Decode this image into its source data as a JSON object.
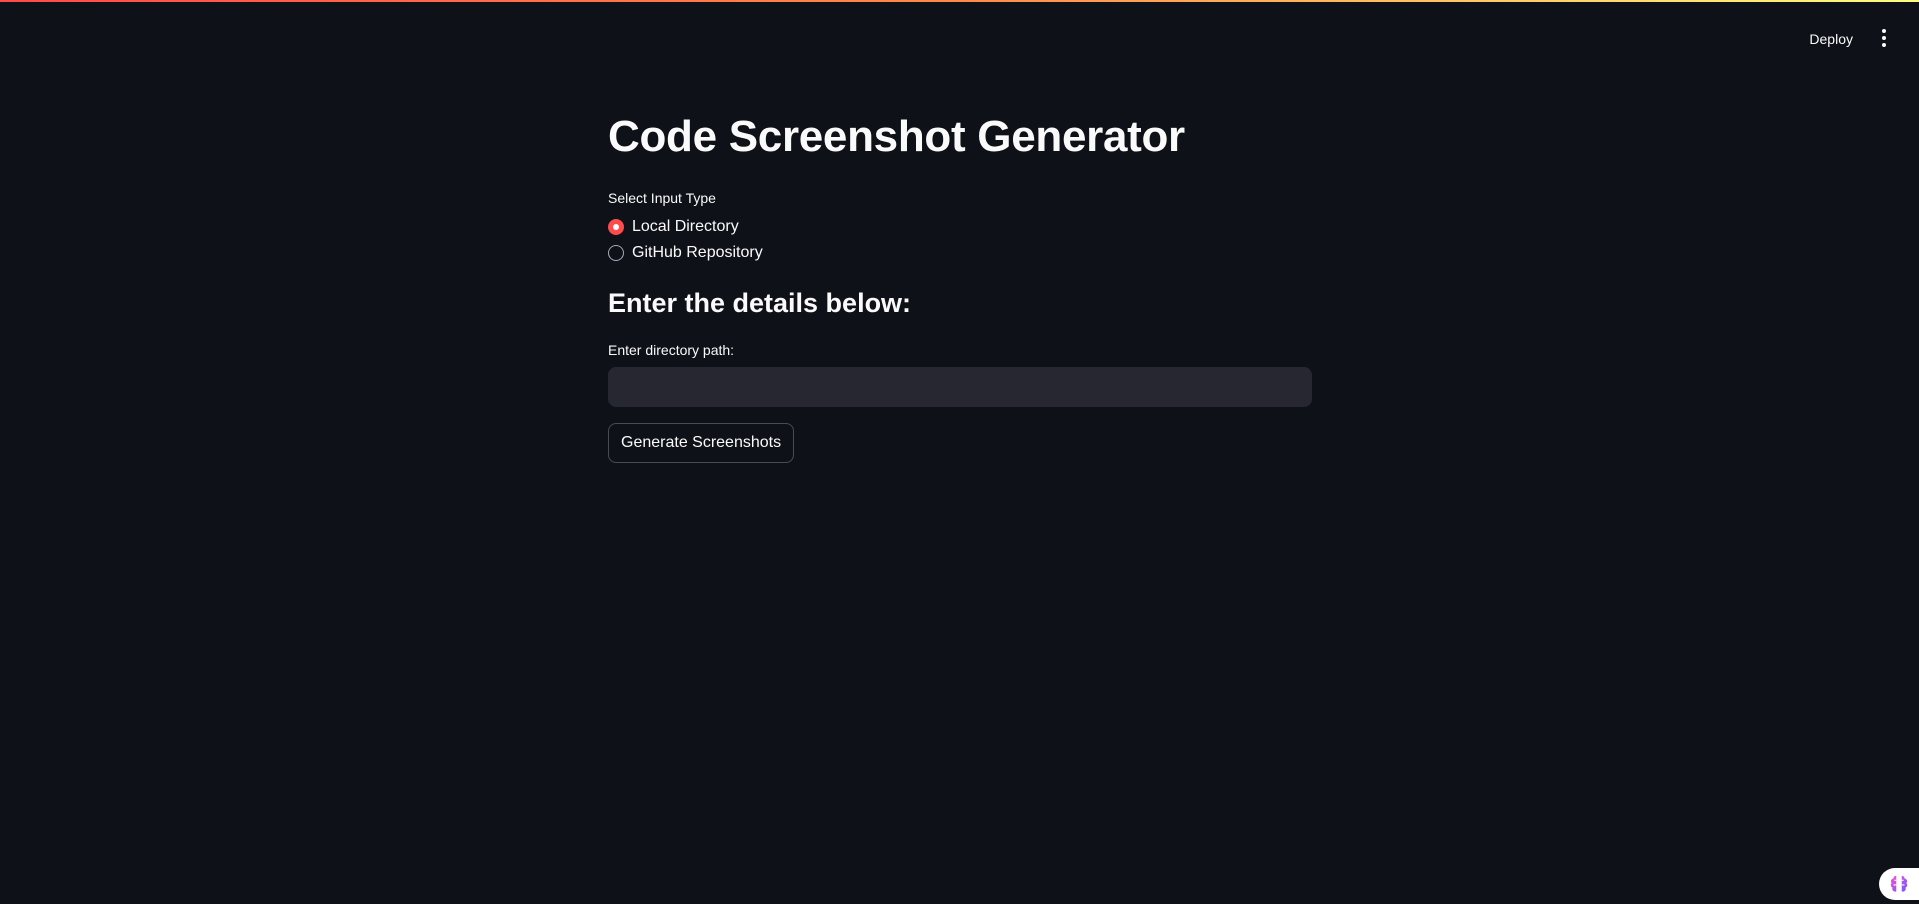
{
  "header": {
    "deploy_label": "Deploy",
    "menu_icon": "vertical-ellipsis-icon"
  },
  "main": {
    "title": "Code Screenshot Generator",
    "radio_group": {
      "label": "Select Input Type",
      "options": [
        {
          "label": "Local Directory",
          "selected": true
        },
        {
          "label": "GitHub Repository",
          "selected": false
        }
      ]
    },
    "subheader": "Enter the details below:",
    "directory_input": {
      "label": "Enter directory path:",
      "value": "",
      "placeholder": ""
    },
    "generate_button_label": "Generate Screenshots"
  },
  "corner_badge": {
    "icon": "brain-icon"
  },
  "colors": {
    "background": "#0e1117",
    "accent": "#ff4b4b",
    "input_bg": "#262730",
    "text": "#fafafa"
  }
}
